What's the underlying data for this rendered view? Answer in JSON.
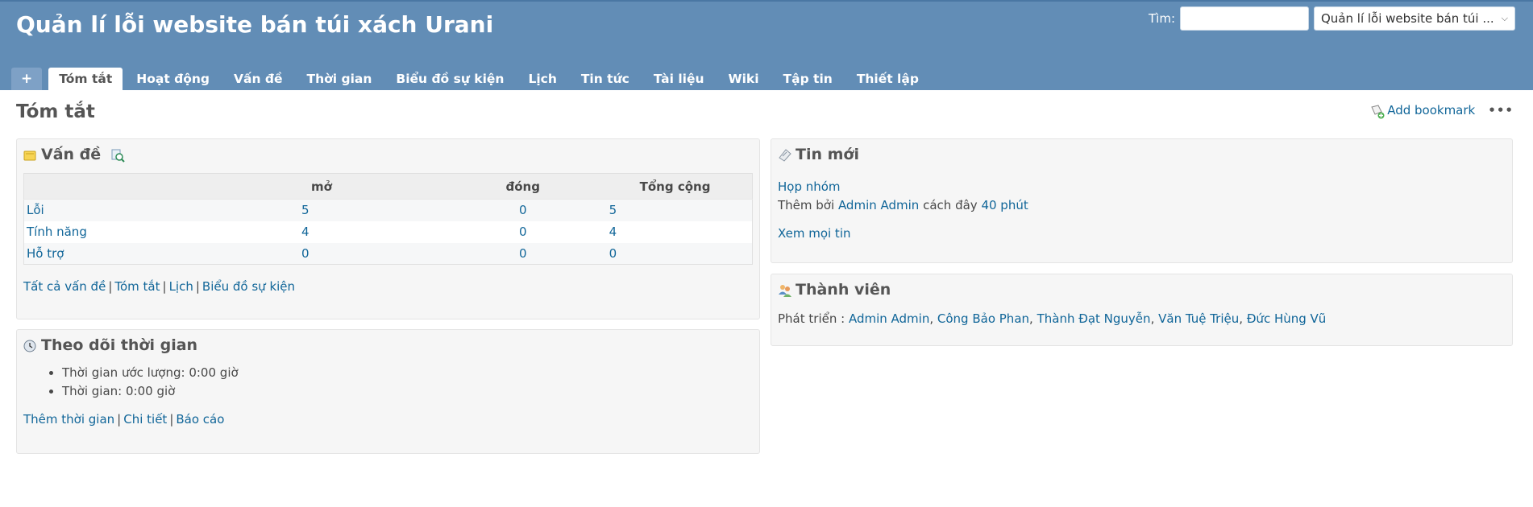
{
  "header": {
    "title": "Quản lí lỗi website bán túi xách Urani",
    "search_label": "Tìm:",
    "search_value": "",
    "project_jump": "Quản lí lỗi website bán túi ..."
  },
  "menu": {
    "new": "+",
    "tabs": [
      "Tóm tắt",
      "Hoạt động",
      "Vấn đề",
      "Thời gian",
      "Biểu đồ sự kiện",
      "Lịch",
      "Tin tức",
      "Tài liệu",
      "Wiki",
      "Tập tin",
      "Thiết lập"
    ],
    "selected": "Tóm tắt"
  },
  "page": {
    "title": "Tóm tắt",
    "add_bookmark": "Add bookmark",
    "more": "•••"
  },
  "issues_box": {
    "title": "Vấn đề",
    "columns": [
      "",
      "mở",
      "đóng",
      "Tổng cộng"
    ],
    "rows": [
      {
        "tracker": "Lỗi",
        "open": "5",
        "closed": "0",
        "total": "5"
      },
      {
        "tracker": "Tính năng",
        "open": "4",
        "closed": "0",
        "total": "4"
      },
      {
        "tracker": "Hỗ trợ",
        "open": "0",
        "closed": "0",
        "total": "0"
      }
    ],
    "links": [
      "Tất cả vấn đề",
      "Tóm tắt",
      "Lịch",
      "Biểu đồ sự kiện"
    ],
    "separator": "|"
  },
  "time_box": {
    "title": "Theo dõi thời gian",
    "estimated": "Thời gian ước lượng: 0:00 giờ",
    "spent": "Thời gian: 0:00 giờ",
    "links": [
      "Thêm thời gian",
      "Chi tiết",
      "Báo cáo"
    ]
  },
  "news_box": {
    "title": "Tin mới",
    "item_title": "Họp nhóm",
    "added_by_prefix": "Thêm bởi",
    "author": "Admin Admin",
    "ago_prefix": "cách đây",
    "ago": "40 phút",
    "view_all": "Xem mọi tin"
  },
  "members_box": {
    "title": "Thành viên",
    "role": "Phát triển :",
    "members": [
      "Admin Admin",
      "Công Bảo Phan",
      "Thành Đạt Nguyễn",
      "Văn Tuệ Triệu",
      "Đức Hùng Vũ"
    ]
  },
  "colors": {
    "header_bg": "#628db6",
    "link": "#116699",
    "box_bg": "#f6f6f6"
  }
}
